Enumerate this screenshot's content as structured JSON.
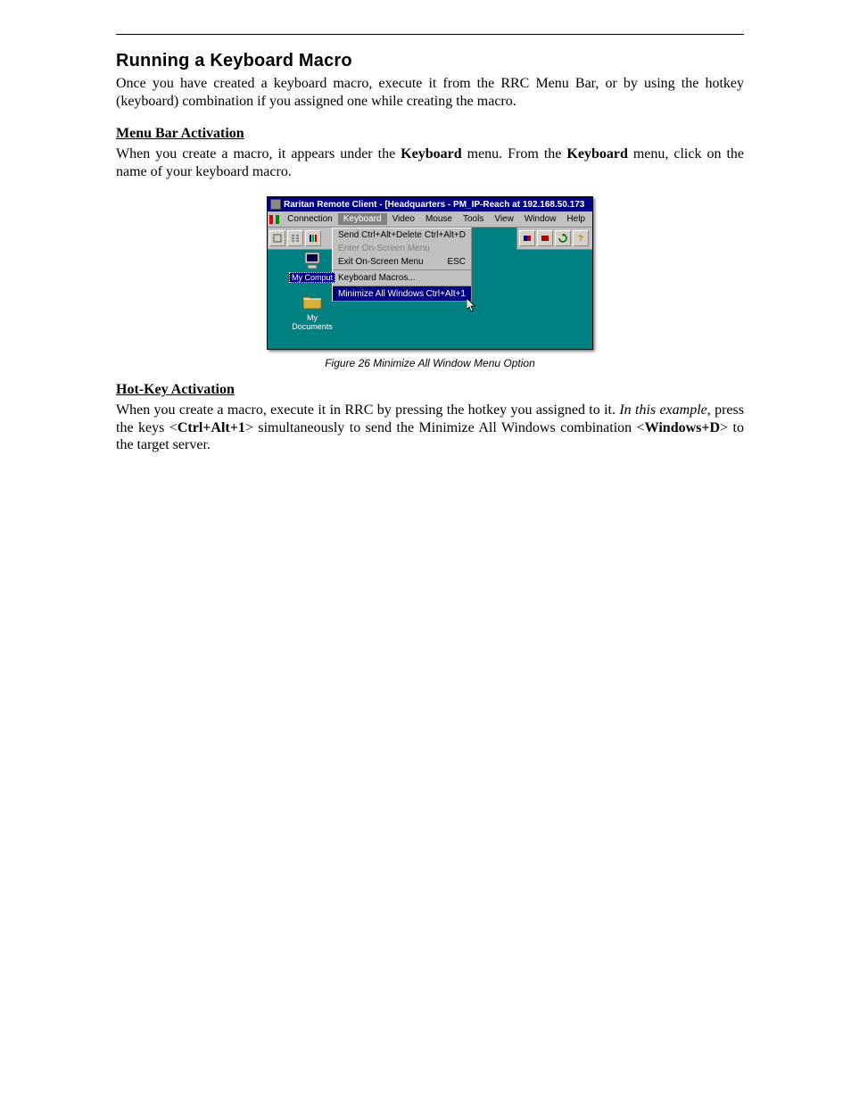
{
  "heading": "Running a Keyboard Macro",
  "intro": "Once you have created a keyboard macro, execute it from the RRC Menu Bar, or by using the hotkey (keyboard) combination if you assigned one while creating the macro.",
  "menubar_section": {
    "title": "Menu Bar Activation",
    "text_before": "When you create a macro, it appears under the ",
    "kw1": "Keyboard",
    "text_mid": " menu. From the ",
    "kw2": "Keyboard",
    "text_after": " menu, click on the name of your keyboard macro."
  },
  "figure": {
    "caption": "Figure 26 Minimize All Window Menu Option",
    "titlebar": "Raritan Remote Client - [Headquarters - PM_IP-Reach at 192.168.50.173",
    "menus": [
      "Connection",
      "Keyboard",
      "Video",
      "Mouse",
      "Tools",
      "View",
      "Window",
      "Help"
    ],
    "active_menu_index": 1,
    "dropdown": [
      {
        "label": "Send Ctrl+Alt+Delete",
        "shortcut": "Ctrl+Alt+D"
      },
      {
        "label": "Enter On-Screen Menu",
        "shortcut": "",
        "disabled": true
      },
      {
        "label": "Exit On-Screen Menu",
        "shortcut": "ESC"
      },
      {
        "label": "Keyboard Macros...",
        "shortcut": "",
        "sep": true
      },
      {
        "label": "Minimize All Windows",
        "shortcut": "Ctrl+Alt+1",
        "sep": true,
        "highlighted": true
      }
    ],
    "desktop_icons": [
      {
        "label": "My Comput",
        "selected": true,
        "kind": "computer"
      },
      {
        "label": "My Documents",
        "selected": false,
        "kind": "folder"
      }
    ]
  },
  "hotkey_section": {
    "title": "Hot-Key Activation",
    "t1": "When you create a macro, execute it in RRC by pressing the hotkey you assigned to it. ",
    "ital": "In this example",
    "t2": ", press the keys <",
    "b1": "Ctrl+Alt+1",
    "t3": "> simultaneously to send the Minimize All Windows combination <",
    "b2": "Windows+D",
    "t4": "> to the target server."
  }
}
